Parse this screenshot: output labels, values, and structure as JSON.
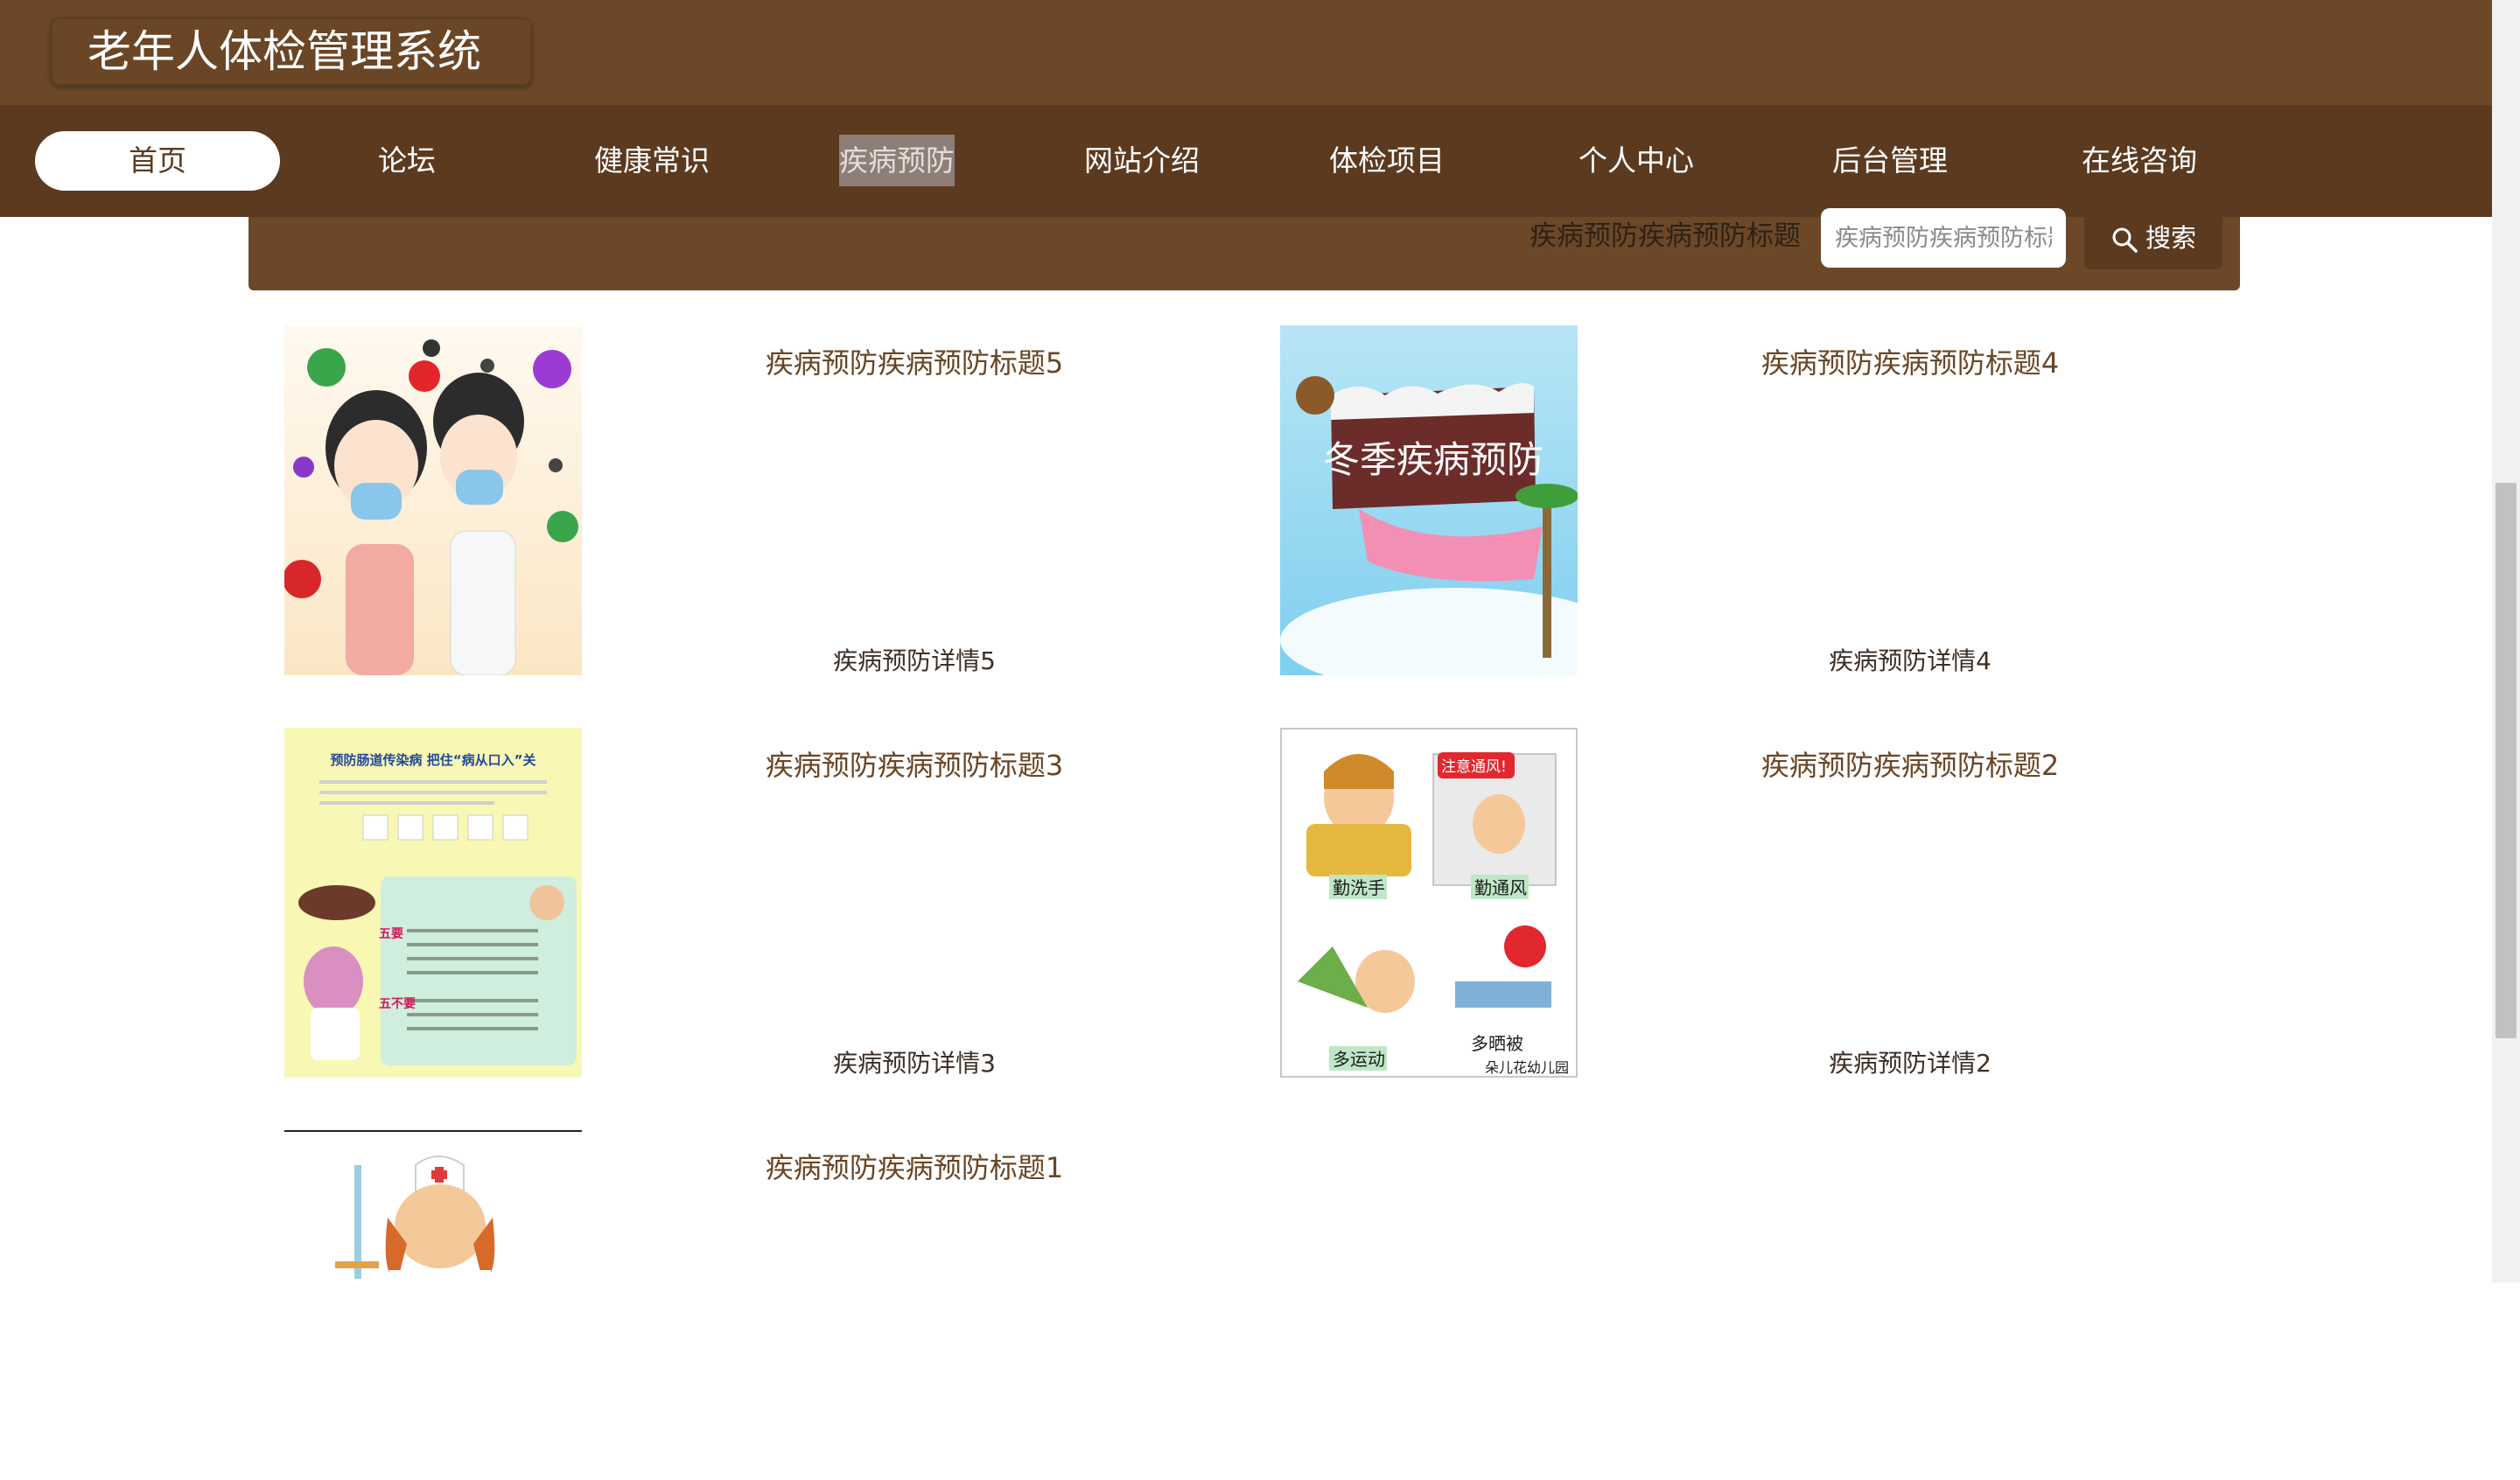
{
  "app": {
    "title": "老年人体检管理系统"
  },
  "nav": {
    "items": [
      {
        "label": "首页"
      },
      {
        "label": "论坛"
      },
      {
        "label": "健康常识"
      },
      {
        "label": "疾病预防"
      },
      {
        "label": "网站介绍"
      },
      {
        "label": "体检项目"
      },
      {
        "label": "个人中心"
      },
      {
        "label": "后台管理"
      },
      {
        "label": "在线咨询"
      }
    ],
    "active": "首页"
  },
  "search": {
    "label": "疾病预防疾病预防标题",
    "placeholder": "疾病预防疾病预防标题",
    "button_label": "搜索"
  },
  "list": [
    {
      "title": "疾病预防疾病预防标题5",
      "detail": "疾病预防详情5",
      "image": "masked-kids-and-viruses"
    },
    {
      "title": "疾病预防疾病预防标题4",
      "detail": "疾病预防详情4",
      "image": "winter-disease-prevention-banner",
      "image_text": "冬季疾病预防"
    },
    {
      "title": "疾病预防疾病预防标题3",
      "detail": "疾病预防详情3",
      "image": "intestinal-disease-poster",
      "image_text": "预防肠道传染病 把住“病从口入”关"
    },
    {
      "title": "疾病预防疾病预防标题2",
      "detail": "疾病预防详情2",
      "image": "kindergarten-hygiene-poster",
      "image_text": [
        "勤洗手",
        "勤通风",
        "多运动",
        "多晒被",
        "注意通风!",
        "朵儿花幼儿园"
      ]
    },
    {
      "title": "疾病预防疾病预防标题1",
      "detail": "",
      "image": "nurse-with-syringe"
    }
  ],
  "colors": {
    "header": "#6c4828",
    "nav": "#5c3a1f",
    "title_text": "#6a4626"
  }
}
